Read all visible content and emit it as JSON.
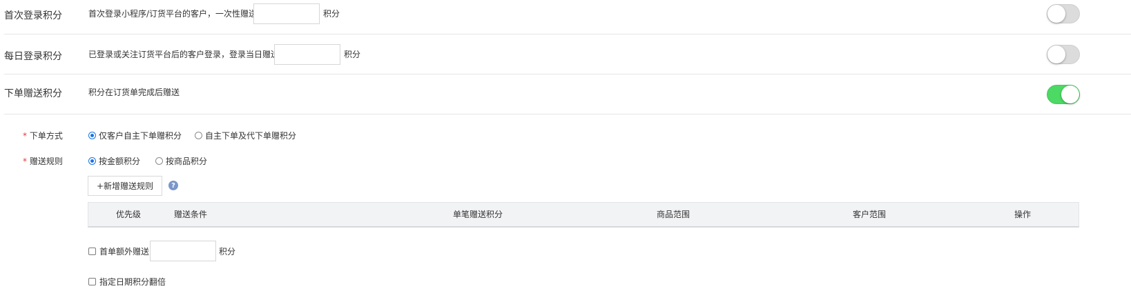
{
  "first_login": {
    "label": "首次登录积分",
    "desc": "首次登录小程序/订货平台的客户，一次性赠送",
    "value": "",
    "unit": "积分",
    "enabled": false
  },
  "daily_login": {
    "label": "每日登录积分",
    "desc": "已登录或关注订货平台后的客户登录，登录当日赠送",
    "value": "",
    "unit": "积分",
    "enabled": false
  },
  "order_reward": {
    "label": "下单赠送积分",
    "desc": "积分在订货单完成后赠送",
    "enabled": true
  },
  "order_method": {
    "required_mark": "*",
    "label": "下单方式",
    "options": [
      "仅客户自主下单赠积分",
      "自主下单及代下单赠积分"
    ],
    "selected": 0
  },
  "reward_rule": {
    "required_mark": "*",
    "label": "赠送规则",
    "options": [
      "按金额积分",
      "按商品积分"
    ],
    "selected": 0
  },
  "add_rule_button": "+新增赠送规则",
  "help_icon": "?",
  "table": {
    "columns": [
      "优先级",
      "赠送条件",
      "单笔赠送积分",
      "商品范围",
      "客户范围",
      "操作"
    ]
  },
  "first_order_extra": {
    "label": "首单额外赠送",
    "value": "",
    "unit": "积分",
    "checked": false
  },
  "date_double": {
    "label": "指定日期积分翻倍",
    "checked": false
  },
  "colors": {
    "accent": "#1a73e8",
    "toggle_on": "#4cd964",
    "toggle_off": "#dcdcdc",
    "required": "#e4393c",
    "help": "#7b96c9"
  }
}
